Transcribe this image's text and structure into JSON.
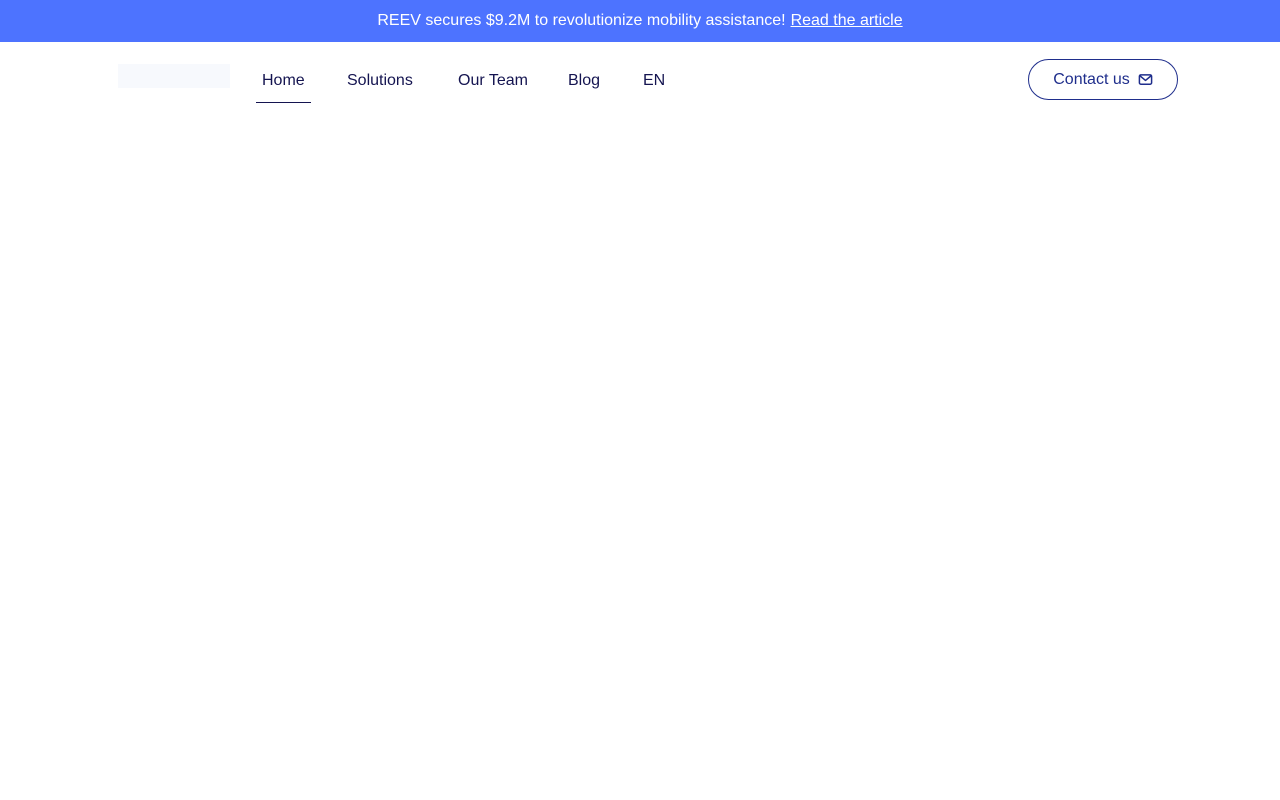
{
  "announcement": {
    "text": "REEV secures $9.2M to revolutionize mobility assistance!",
    "link_text": "Read the article"
  },
  "nav": {
    "items": [
      {
        "label": "Home",
        "active": true
      },
      {
        "label": "Solutions"
      },
      {
        "label": "Our Team"
      },
      {
        "label": "Blog"
      },
      {
        "label": "EN"
      }
    ]
  },
  "header": {
    "contact_label": "Contact us",
    "contact_icon": "mail-icon"
  },
  "colors": {
    "banner_bg": "#4d73ff",
    "nav_text": "#141450",
    "button_border": "#1f2e8c"
  }
}
